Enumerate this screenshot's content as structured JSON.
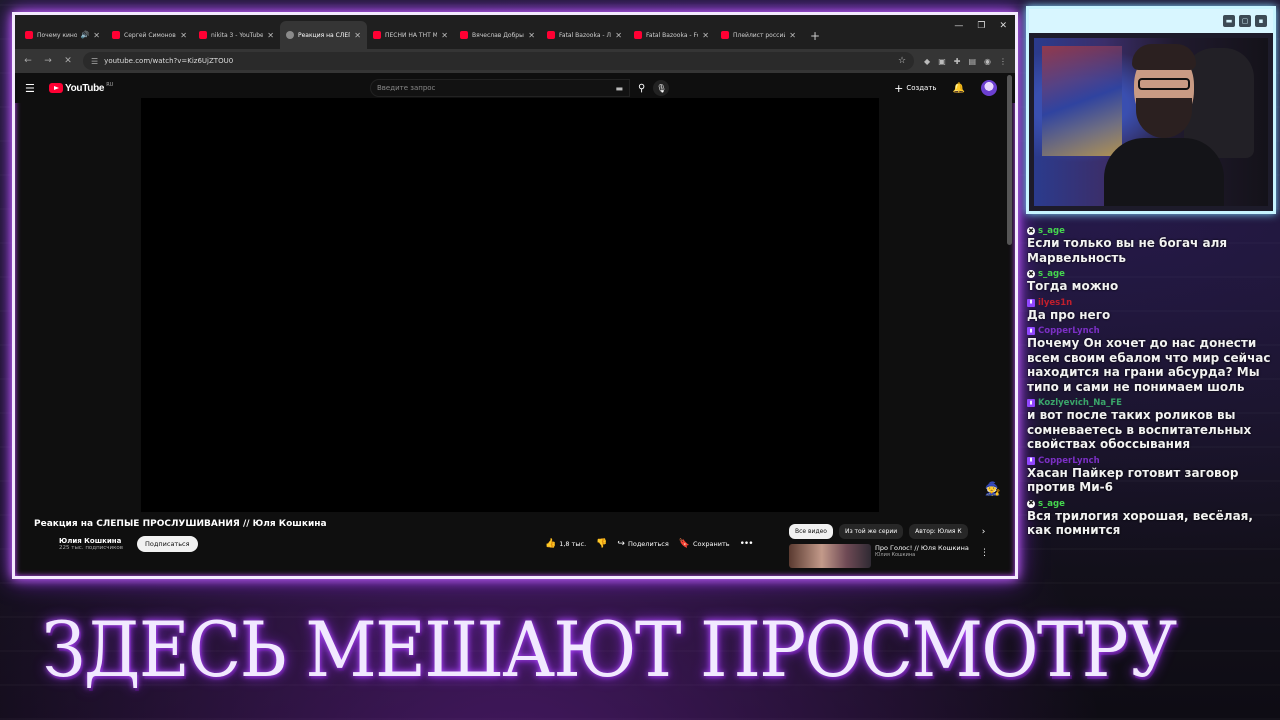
{
  "browser": {
    "tabs": [
      {
        "title": "Почему кино с"
      },
      {
        "title": "Сергей Симонов -"
      },
      {
        "title": "nikita 3 - YouTube"
      },
      {
        "title": "Реакция на СЛЕПЫ"
      },
      {
        "title": "ПЕСНИ НА ТНТ МУ"
      },
      {
        "title": "Вячеслав Добрын"
      },
      {
        "title": "Fatal Bazooka - Ла"
      },
      {
        "title": "Fatal Bazooka - Fou"
      },
      {
        "title": "Плейлист российс"
      }
    ],
    "active_tab_index": 3,
    "url": "youtube.com/watch?v=Kiz6UjZTOU0"
  },
  "youtube": {
    "logo": "YouTube",
    "region": "RU",
    "search_placeholder": "Введите запрос",
    "create_label": "Создать",
    "video": {
      "title": "Реакция на СЛЕПЫЕ ПРОСЛУШИВАНИЯ // Юля Кошкина",
      "channel": "Юлия Кошкина",
      "subscribers": "225 тыс. подписчиков",
      "subscribe_label": "Подписаться",
      "likes": "1,8 тыс.",
      "share_label": "Поделиться",
      "save_label": "Сохранить"
    },
    "chips": [
      "Все видео",
      "Из той же серии",
      "Автор: Юлия К"
    ],
    "recommendation": {
      "title": "Про Голос! // Юля Кошкина",
      "channel": "Юлия Кошкина"
    }
  },
  "chat": {
    "messages": [
      {
        "user": "s_age",
        "user_color": "#45d64e",
        "badge": "icon",
        "text": "Если только вы не богач аля Марвельность"
      },
      {
        "user": "s_age",
        "user_color": "#45d64e",
        "badge": "icon",
        "text": "Тогда можно"
      },
      {
        "user": "ilyes1n",
        "user_color": "#c21e2c",
        "badge": "twitch",
        "text": "Да про него"
      },
      {
        "user": "CopperLynch",
        "user_color": "#7b2fc4",
        "badge": "twitch",
        "text": "Почему Он хочет до нас донести всем своим ебалом что мир сейчас находится на грани абсурда? Мы типо и сами не понимаем шоль"
      },
      {
        "user": "Kozlyevich_Na_FE",
        "user_color": "#3aa66a",
        "badge": "twitch",
        "text": "и вот после таких роликов вы сомневаетесь в воспитательных свойствах обоссывания"
      },
      {
        "user": "CopperLynch",
        "user_color": "#7b2fc4",
        "badge": "twitch",
        "text": "Хасан Пайкер готовит заговор против Ми-6"
      },
      {
        "user": "s_age",
        "user_color": "#45d64e",
        "badge": "icon",
        "text": "Вся трилогия хорошая, весёлая, как помнится"
      }
    ]
  },
  "banner": {
    "text": "ЗДЕСЬ МЕШАЮТ ПРОСМОТРУ"
  }
}
